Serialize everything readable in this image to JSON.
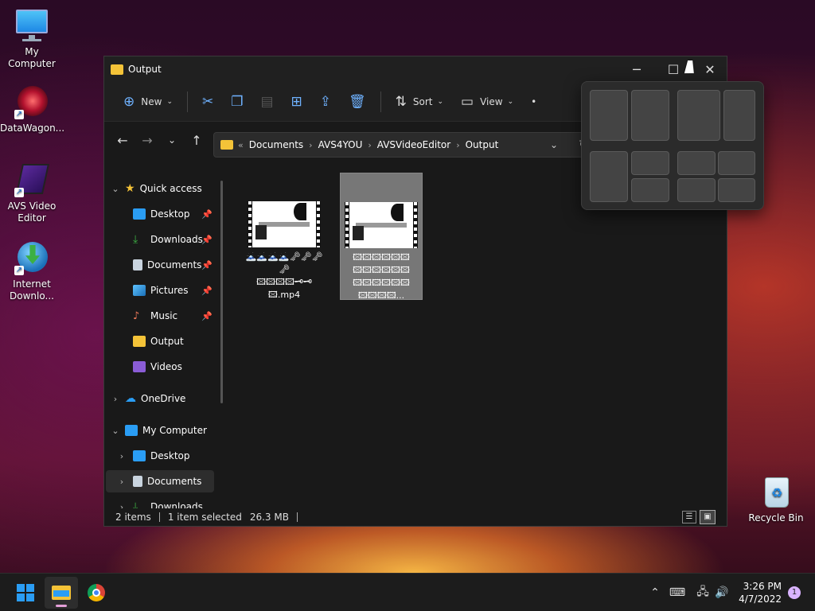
{
  "desktop": {
    "icons": [
      {
        "label": "My Computer"
      },
      {
        "label": "DataWagon..."
      },
      {
        "label": "AVS Video Editor"
      },
      {
        "label": "Internet Downlo..."
      },
      {
        "label": "Recycle Bin"
      }
    ]
  },
  "window": {
    "title": "Output",
    "controls": {
      "minimize": "─",
      "maximize": "☐",
      "close": "✕"
    }
  },
  "toolbar": {
    "new_label": "New",
    "sort_label": "Sort",
    "view_label": "View",
    "more_label": "•"
  },
  "address": {
    "prefix": "«",
    "crumbs": [
      "Documents",
      "AVS4YOU",
      "AVSVideoEditor",
      "Output"
    ]
  },
  "sidebar": {
    "items": [
      {
        "label": "Quick access"
      },
      {
        "label": "Desktop"
      },
      {
        "label": "Downloads"
      },
      {
        "label": "Documents"
      },
      {
        "label": "Pictures"
      },
      {
        "label": "Music"
      },
      {
        "label": "Output"
      },
      {
        "label": "Videos"
      },
      {
        "label": "OneDrive"
      },
      {
        "label": "My Computer"
      },
      {
        "label": "Desktop"
      },
      {
        "label": "Documents"
      },
      {
        "label": "Downloads"
      }
    ]
  },
  "files": [
    {
      "name_line1": "🗻🗻🗻🗻🗝🗝🗝🗝",
      "name_line2": "🖾🖾🖾🖾🗝🗝",
      "name_line3": "🖾.mp4"
    },
    {
      "name_line1": "🖾🖾🖾🖾🖾🖾",
      "name_line2": "🖾🖾🖾🖾🖾🖾",
      "name_line3": "🖾🖾🖾🖾🖾🖾",
      "name_line4": "🖾🖾🖾🖾..."
    }
  ],
  "status": {
    "items": "2 items",
    "selected": "1 item selected",
    "size": "26.3 MB"
  },
  "taskbar": {
    "time": "3:26 PM",
    "date": "4/7/2022",
    "notifications": "1"
  }
}
